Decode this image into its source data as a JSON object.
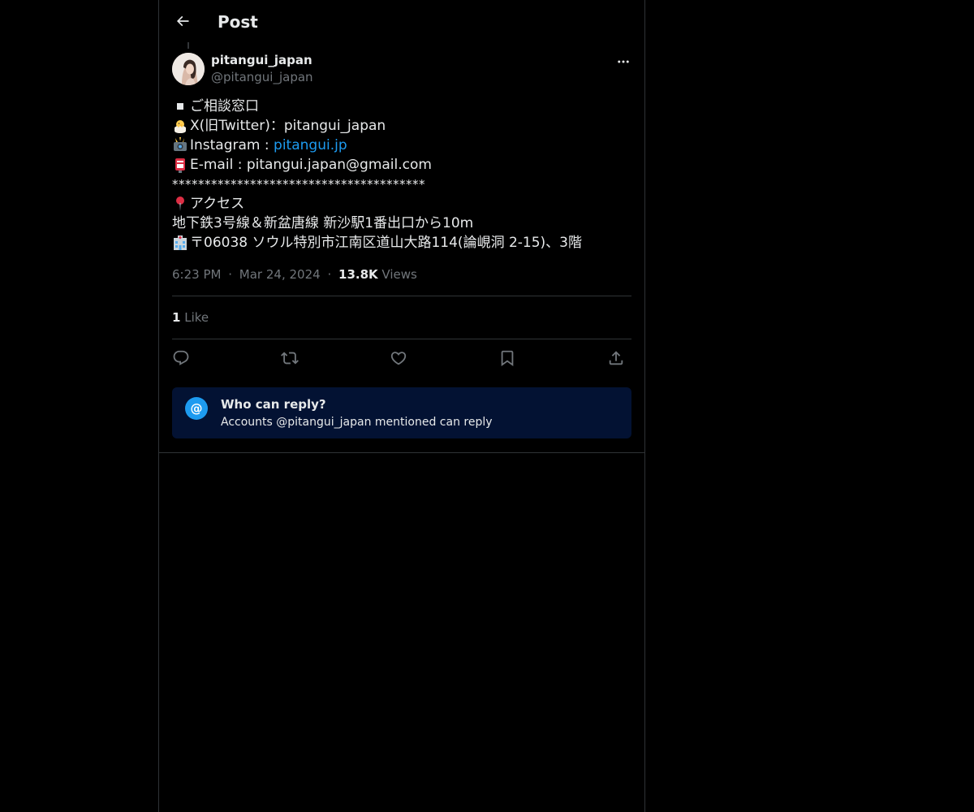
{
  "header": {
    "title": "Post",
    "back_icon": "arrow-left-icon"
  },
  "author": {
    "display_name": "pitangui_japan",
    "handle": "@pitangui_japan",
    "avatar": "profile-photo"
  },
  "tweet": {
    "line1_icon": "black-square",
    "line1": "ご相談窓口",
    "line2_icon": "hatching-chick-emoji",
    "line2": "X(旧Twitter)：pitangui_japan",
    "line3_icon": "camera-flash-emoji",
    "line3_prefix": "Instagram : ",
    "line3_link": "pitangui.jp",
    "line4_icon": "postbox-emoji",
    "line4": "E-mail : pitangui.japan@gmail.com",
    "line5": "***************************************",
    "line6_icon": "round-pushpin-emoji",
    "line6": "アクセス",
    "line7": "地下鉄3号線＆新盆唐線 新沙駅1番出口から10m",
    "line8_icon": "hospital-building-emoji",
    "line8": "〒06038 ソウル特別市江南区道山大路114(論峴洞 2-15)、3階"
  },
  "meta": {
    "time": "6:23 PM",
    "sep1": "·",
    "date": "Mar 24, 2024",
    "sep2": "·",
    "views_count": "13.8K",
    "views_label": " Views"
  },
  "engagement": {
    "likes_count": "1",
    "likes_label": " Like"
  },
  "actions": [
    "reply-icon",
    "repost-icon",
    "like-icon",
    "bookmark-icon",
    "share-icon"
  ],
  "reply_restriction": {
    "icon": "at-sign-icon",
    "icon_glyph": "@",
    "title": "Who can reply?",
    "subtitle": "Accounts @pitangui_japan mentioned can reply"
  },
  "colors": {
    "background": "#000000",
    "text": "#e7e9ea",
    "secondary_text": "#71767b",
    "link": "#1d9bf0",
    "border": "#2f3336",
    "reply_box_bg": "#031233"
  }
}
